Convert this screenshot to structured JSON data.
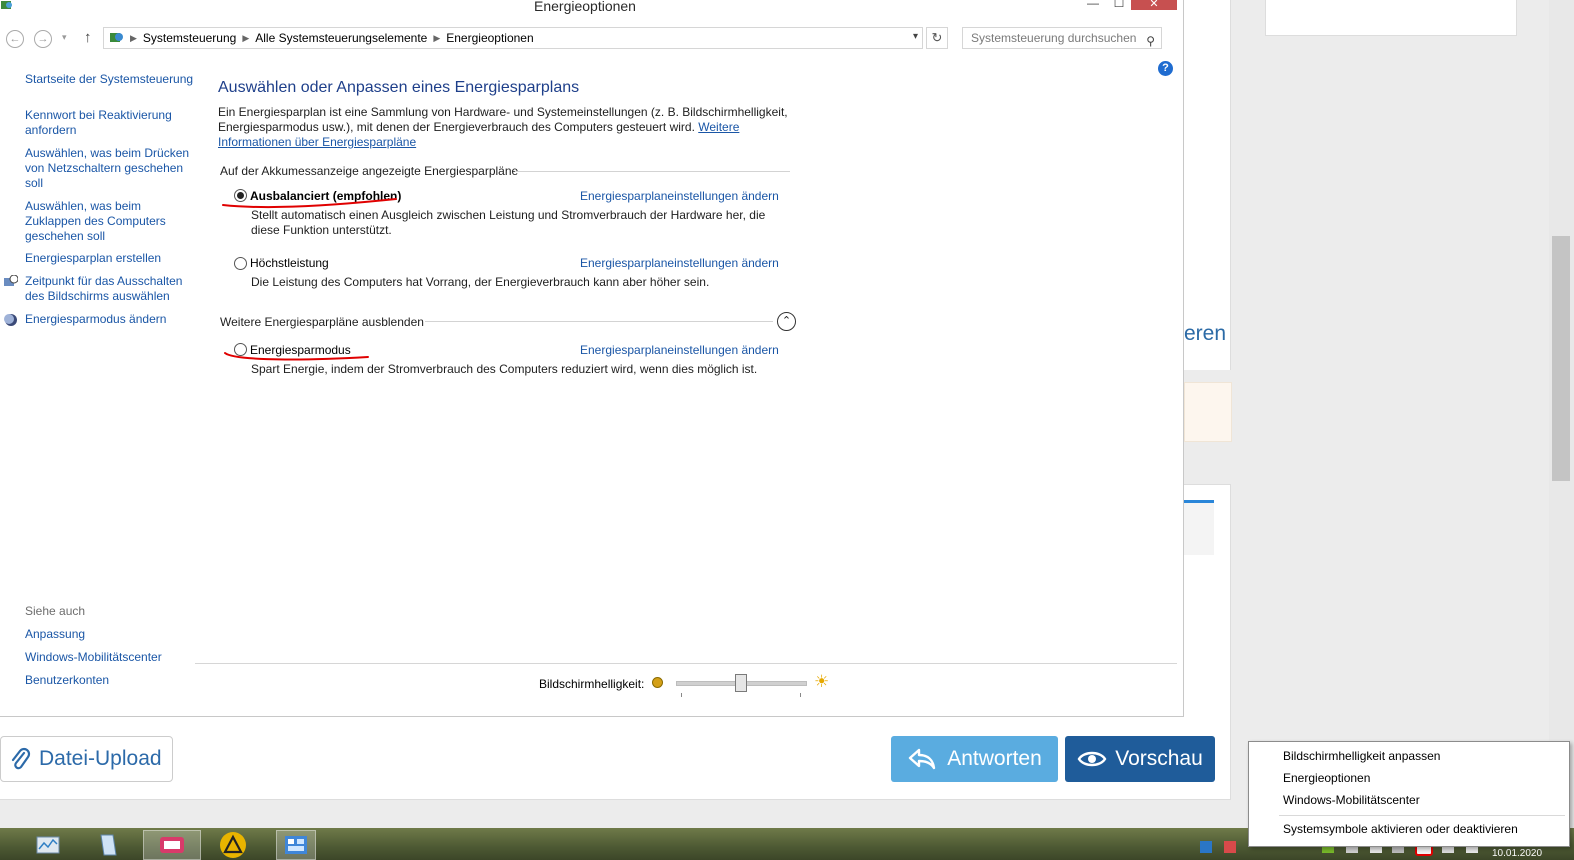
{
  "window": {
    "title": "Energieoptionen",
    "controls": {
      "minimize": "—",
      "maximize": "☐",
      "close": "✕"
    }
  },
  "address_bar": {
    "breadcrumb": [
      "Systemsteuerung",
      "Alle Systemsteuerungselemente",
      "Energieoptionen"
    ],
    "search_placeholder": "Systemsteuerung durchsuchen"
  },
  "left_nav": {
    "home": "Startseite der Systemsteuerung",
    "links": [
      "Kennwort bei Reaktivierung anfordern",
      "Auswählen, was beim Drücken von Netzschaltern geschehen soll",
      "Auswählen, was beim Zuklappen des Computers geschehen soll",
      "Energiesparplan erstellen",
      "Zeitpunkt für das Ausschalten des Bildschirms auswählen",
      "Energiesparmodus ändern"
    ],
    "see_also_label": "Siehe auch",
    "see_also": [
      "Anpassung",
      "Windows-Mobilitätscenter",
      "Benutzerkonten"
    ]
  },
  "main": {
    "title": "Auswählen oder Anpassen eines Energiesparplans",
    "intro": "Ein Energiesparplan ist eine Sammlung von Hardware- und Systemeinstellungen (z. B. Bildschirmhelligkeit, Energiesparmodus usw.), mit denen der Energieverbrauch des Computers gesteuert wird.",
    "intro_link": "Weitere Informationen über Energiesparpläne",
    "group1_label": "Auf der Akkumessanzeige angezeigte Energiesparpläne",
    "group2_label": "Weitere Energiesparpläne ausblenden",
    "change_link": "Energiesparplaneinstellungen ändern",
    "plans": [
      {
        "name": "Ausbalanciert (empfohlen)",
        "selected": true,
        "description": "Stellt automatisch einen Ausgleich zwischen Leistung und Stromverbrauch der Hardware her, die diese Funktion unterstützt."
      },
      {
        "name": "Höchstleistung",
        "selected": false,
        "description": "Die Leistung des Computers hat Vorrang, der Energieverbrauch kann aber höher sein."
      },
      {
        "name": "Energiesparmodus",
        "selected": false,
        "description": "Spart Energie, indem der Stromverbrauch des Computers reduziert wird, wenn dies möglich ist."
      }
    ],
    "brightness_label": "Bildschirmhelligkeit:",
    "brightness_value": 0.5
  },
  "background_page": {
    "partial_link_text": "eren",
    "upload_button": "Datei-Upload",
    "answer_button": "Antworten",
    "preview_button": "Vorschau"
  },
  "tray_menu": {
    "items": [
      "Bildschirmhelligkeit anpassen",
      "Energieoptionen",
      "Windows-Mobilitätscenter",
      "Systemsymbole aktivieren oder deaktivieren"
    ]
  },
  "taskbar": {
    "clock_date": "10.01.2020"
  },
  "colors": {
    "link": "#1a56a6",
    "title_blue": "#1e3f8a",
    "answer_button": "#5aace0",
    "preview_button": "#1f5c9a",
    "annotation_red": "#e00000"
  }
}
